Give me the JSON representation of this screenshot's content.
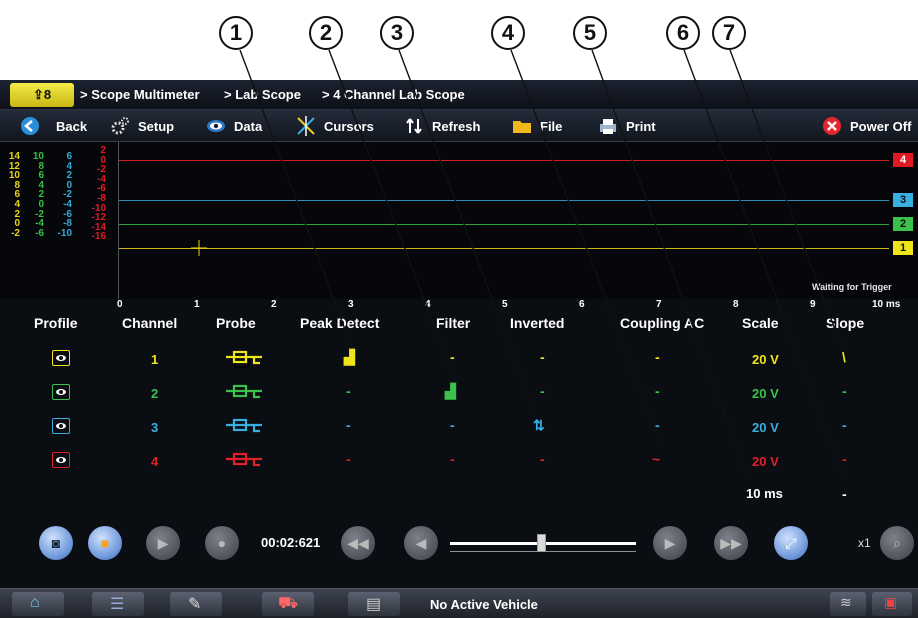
{
  "callouts": [
    "1",
    "2",
    "3",
    "4",
    "5",
    "6",
    "7"
  ],
  "breadcrumb": {
    "home": "⇪8",
    "items": [
      "> Scope Multimeter",
      "> Lab Scope",
      "> 4 Channel Lab Scope"
    ]
  },
  "toolbar": {
    "back": "Back",
    "setup": "Setup",
    "data": "Data",
    "cursors": "Cursors",
    "refresh": "Refresh",
    "file": "File",
    "print": "Print",
    "power_off": "Power Off"
  },
  "scope": {
    "scale_columns": [
      {
        "color": "#e8d21a",
        "values": [
          "14",
          "12",
          "10",
          "8",
          "6",
          "4",
          "2",
          "0",
          "-2"
        ]
      },
      {
        "color": "#36c144",
        "values": [
          "10",
          "8",
          "6",
          "4",
          "2",
          "0",
          "-2",
          "-4",
          "-6"
        ]
      },
      {
        "color": "#38a9d6",
        "values": [
          "6",
          "4",
          "2",
          "0",
          "-2",
          "-4",
          "-6",
          "-8",
          "-10"
        ]
      },
      {
        "color": "#e01a22",
        "values": [
          "2",
          "0",
          "-2",
          "-4",
          "-6",
          "-8",
          "-10",
          "-12",
          "-14",
          "-16"
        ]
      }
    ],
    "channel_tags": [
      "4",
      "3",
      "2",
      "1"
    ],
    "status": "Waiting for Trigger",
    "x_ticks": [
      "0",
      "1",
      "2",
      "3",
      "4",
      "5",
      "6",
      "7",
      "8",
      "9",
      "10 ms"
    ]
  },
  "table": {
    "headers": [
      "Profile",
      "Channel",
      "Probe",
      "Peak Detect",
      "Filter",
      "Inverted",
      "Coupling AC",
      "Scale",
      "Slope"
    ],
    "rows": [
      {
        "channel": "1",
        "color": "#f0e51a",
        "peak": "▟",
        "filter": "-",
        "inverted": "-",
        "coupling": "-",
        "scale": "20 V",
        "slope": "\\"
      },
      {
        "channel": "2",
        "color": "#3cc24a",
        "peak": "-",
        "filter": "▟",
        "inverted": "-",
        "coupling": "-",
        "scale": "20 V",
        "slope": "-"
      },
      {
        "channel": "3",
        "color": "#3aaee0",
        "peak": "-",
        "filter": "-",
        "inverted": "⇅",
        "coupling": "-",
        "scale": "20 V",
        "slope": "-"
      },
      {
        "channel": "4",
        "color": "#e3202a",
        "peak": "-",
        "filter": "-",
        "inverted": "-",
        "coupling": "~",
        "scale": "20 V",
        "slope": "-"
      }
    ],
    "footer_scale": "10 ms",
    "footer_slope": "-"
  },
  "controls": {
    "timer": "00:02:621",
    "zoom": "x1"
  },
  "taskbar": {
    "vehicle": "No Active Vehicle"
  }
}
